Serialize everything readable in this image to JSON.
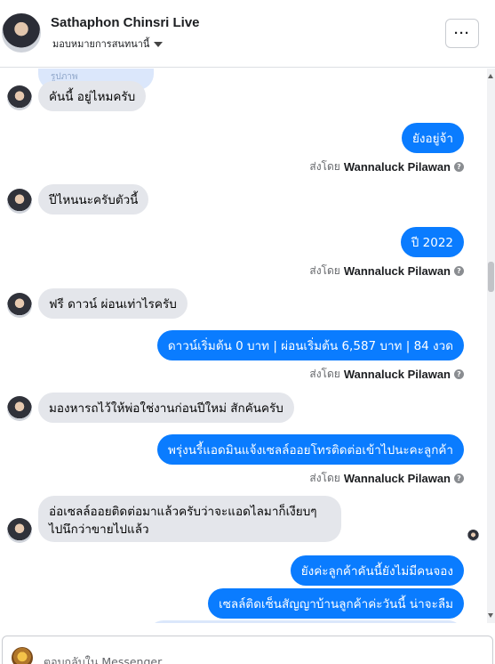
{
  "header": {
    "title": "Sathaphon Chinsri Live",
    "subtitle": "มอบหมายการสนทนานี้",
    "more_label": "···"
  },
  "partial_top_text": "รูปภาพ",
  "messages": [
    {
      "id": "m1",
      "dir": "in",
      "text": "คันนี้ อยู่ไหมครับ"
    },
    {
      "id": "m2",
      "dir": "out",
      "text": "ยังอยู่จ้า",
      "sent_by_prefix": "ส่งโดย",
      "sent_by_name": "Wannaluck Pilawan"
    },
    {
      "id": "m3",
      "dir": "in",
      "text": "ปีไหนนะครับตัวนี้"
    },
    {
      "id": "m4",
      "dir": "out",
      "text": "ปี 2022",
      "sent_by_prefix": "ส่งโดย",
      "sent_by_name": "Wannaluck Pilawan"
    },
    {
      "id": "m5",
      "dir": "in",
      "text": "ฟรี ดาวน์ ผ่อนเท่าไรครับ"
    },
    {
      "id": "m6",
      "dir": "out",
      "text": "ดาวน์เริ่มต้น 0 บาท | ผ่อนเริ่มต้น  6,587 บาท | 84 งวด",
      "sent_by_prefix": "ส่งโดย",
      "sent_by_name": "Wannaluck Pilawan"
    },
    {
      "id": "m7",
      "dir": "in",
      "text": "มองหารถไว้ให้พ่อใช่งานก่อนปีใหม่ สักคันครับ"
    },
    {
      "id": "m8",
      "dir": "out",
      "text": "พรุ่งนรี้แอดมินแจ้งเซลล์ออยโทรติดต่อเข้าไปนะคะลูกค้า",
      "sent_by_prefix": "ส่งโดย",
      "sent_by_name": "Wannaluck Pilawan"
    },
    {
      "id": "m9",
      "dir": "in",
      "line1": "อ่อเซลล์ออยติดต่อมาแล้วครับว่าจะแอดไลมาก็เงียบๆ",
      "line2": "ไปนึกว่าขายไปแล้ว"
    },
    {
      "id": "m10",
      "dir": "out",
      "text": "ยังค่ะลูกค้าคันนี้ยังไม่มีคนจอง"
    },
    {
      "id": "m11",
      "dir": "out",
      "text": "เซลล์ติดเซ็นสัญญาบ้านลูกค้าค่ะวันนี้ น่าจะลืม"
    }
  ],
  "composer": {
    "placeholder": "ตอบกลับใน Messenger..."
  },
  "colors": {
    "outgoing_bubble": "#0a7cff",
    "incoming_bubble": "#e4e6eb"
  }
}
